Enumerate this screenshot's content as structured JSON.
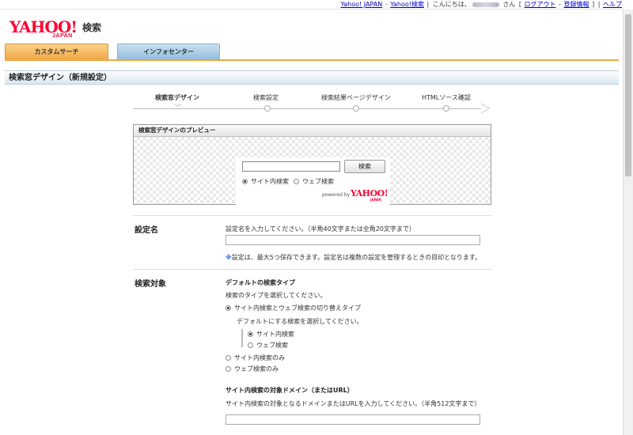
{
  "topnav": {
    "yahoo_japan": "Yahoo! JAPAN",
    "sep1": "-",
    "yahoo_search": "Yahoo!検索",
    "sep2": "|",
    "greeting_prefix": "こんにちは、",
    "greeting_suffix": "さん",
    "bracket_open": "[",
    "logout": "ログアウト",
    "sep3": "-",
    "account": "登録情報",
    "bracket_close": "]",
    "sep4": "|",
    "help": "ヘルプ"
  },
  "logo": {
    "yahoo": "YAHOO!",
    "japan": "JAPAN",
    "kensaku": "検索"
  },
  "tabs": [
    {
      "label": "カスタムサーチ"
    },
    {
      "label": "インフォセンター"
    }
  ],
  "page_title": "検索窓デザイン（新規設定）",
  "steps": [
    {
      "label": "検索窓デザイン"
    },
    {
      "label": "検索設定"
    },
    {
      "label": "検索結果ページデザイン"
    },
    {
      "label": "HTMLソース確認"
    }
  ],
  "preview": {
    "title": "検索窓デザインのプレビュー",
    "search_button": "検索",
    "radio_site": "サイト内検索",
    "radio_web": "ウェブ検索",
    "powered_by": "powered by",
    "logo": "YAHOO!",
    "logo_japan": "JAPAN"
  },
  "form": {
    "name": {
      "label": "設定名",
      "instruction": "設定名を入力してください。（半角40文字または全角20文字まで）",
      "input_value": "",
      "note_mark": "※",
      "note": "設定は、最大5つ保存できます。設定名は複数の設定を管理するときの目印となります。"
    },
    "target": {
      "label": "検索対象",
      "default_heading": "デフォルトの検索タイプ",
      "default_instruction": "検索のタイプを選択してください。",
      "option_switch": "サイト内検索とウェブ検索の切り替えタイプ",
      "default_select_instruction": "デフォルトにする検索を選択してください。",
      "sub_site": "サイト内検索",
      "sub_web": "ウェブ検索",
      "option_site_only": "サイト内検索のみ",
      "option_web_only": "ウェブ検索のみ",
      "domain_heading": "サイト内検索の対象ドメイン（またはURL）",
      "domain_instruction": "サイト内検索の対象となるドメインまたはURLを入力してください。（半角512文字まで）",
      "domain_value": ""
    }
  },
  "selected": {
    "preview_radio": "site",
    "search_type": "switch",
    "default_search": "site"
  }
}
